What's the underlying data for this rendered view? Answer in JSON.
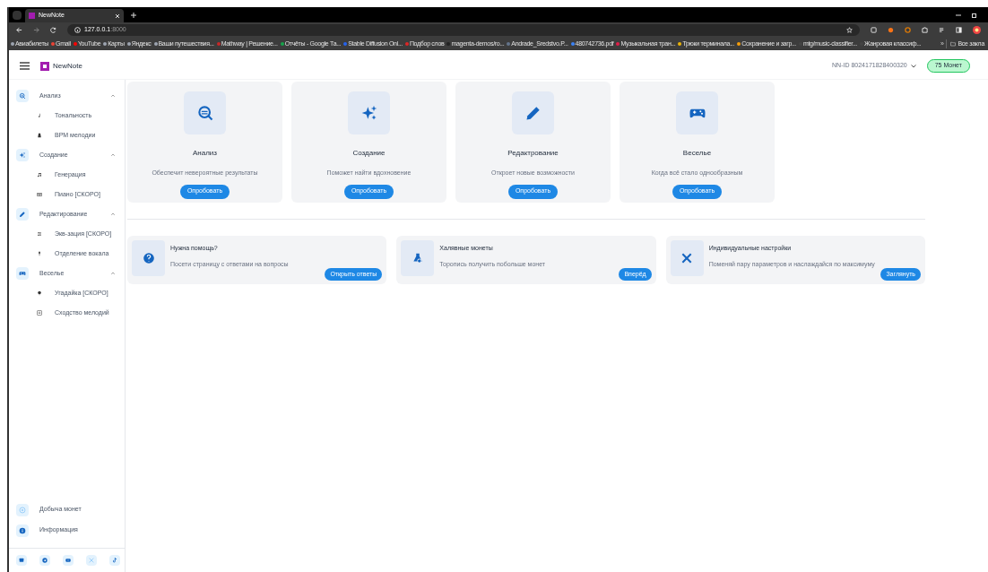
{
  "browser": {
    "tab_title": "NewNote",
    "url_host": "127.0.0.1",
    "url_port": ":8000",
    "bookmarks": [
      "Авиабилеты",
      "Gmail",
      "YouTube",
      "Карты",
      "Яндекс",
      "Ваши путешествия...",
      "Mathway | Решение...",
      "Отчёты - Google Та...",
      "Stable Diffusion Onl...",
      "Подбор слов",
      "magenta-demos/ro...",
      "Andrade_Sredstvo.P...",
      "480742736.pdf",
      "Музыкальная тран...",
      "Трюки терминала...",
      "Сохранение и загр...",
      "mtg/music-classifier...",
      "Жанровая классиф..."
    ],
    "overflow": "»",
    "all_bookmarks": "Все закла"
  },
  "header": {
    "brand": "NewNote",
    "user_id": "NN-ID 8024171828400320",
    "coins": "75 Монет"
  },
  "sidebar": {
    "sections": [
      {
        "label": "Анализ",
        "expanded": true,
        "children": [
          {
            "label": "Тональность"
          },
          {
            "label": "BPM мелодии"
          }
        ]
      },
      {
        "label": "Создание",
        "expanded": true,
        "children": [
          {
            "label": "Генерация"
          },
          {
            "label": "Пиано [СКОРО]"
          }
        ]
      },
      {
        "label": "Редактирование",
        "expanded": true,
        "children": [
          {
            "label": "Экв-зация [СКОРО]"
          },
          {
            "label": "Отделение вокала"
          }
        ]
      },
      {
        "label": "Веселье",
        "expanded": true,
        "children": [
          {
            "label": "Угадайка [СКОРО]"
          },
          {
            "label": "Сходство мелодий"
          }
        ]
      }
    ],
    "bottom_items": [
      {
        "label": "Добыча монет"
      },
      {
        "label": "Информация"
      }
    ]
  },
  "features": [
    {
      "title": "Анализ",
      "subtitle": "Обеспечит невероятные результаты",
      "button": "Опробовать"
    },
    {
      "title": "Создание",
      "subtitle": "Поможет найти вдохновение",
      "button": "Опробовать"
    },
    {
      "title": "Редактрование",
      "subtitle": "Откроет новые возможности",
      "button": "Опробовать"
    },
    {
      "title": "Веселье",
      "subtitle": "Когда всё стало однообразным",
      "button": "Опробовать"
    }
  ],
  "promos": [
    {
      "title": "Нужна помощь?",
      "text": "Посети страницу с ответами на вопросы",
      "button": "Открыть ответы"
    },
    {
      "title": "Халявные монеты",
      "text": "Торопись получить побольше монет",
      "button": "Вперёд"
    },
    {
      "title": "Индивидуальные настройки",
      "text": "Поменяй пару параметров и наслаждайся по максимуму",
      "button": "Заглянуть"
    }
  ]
}
